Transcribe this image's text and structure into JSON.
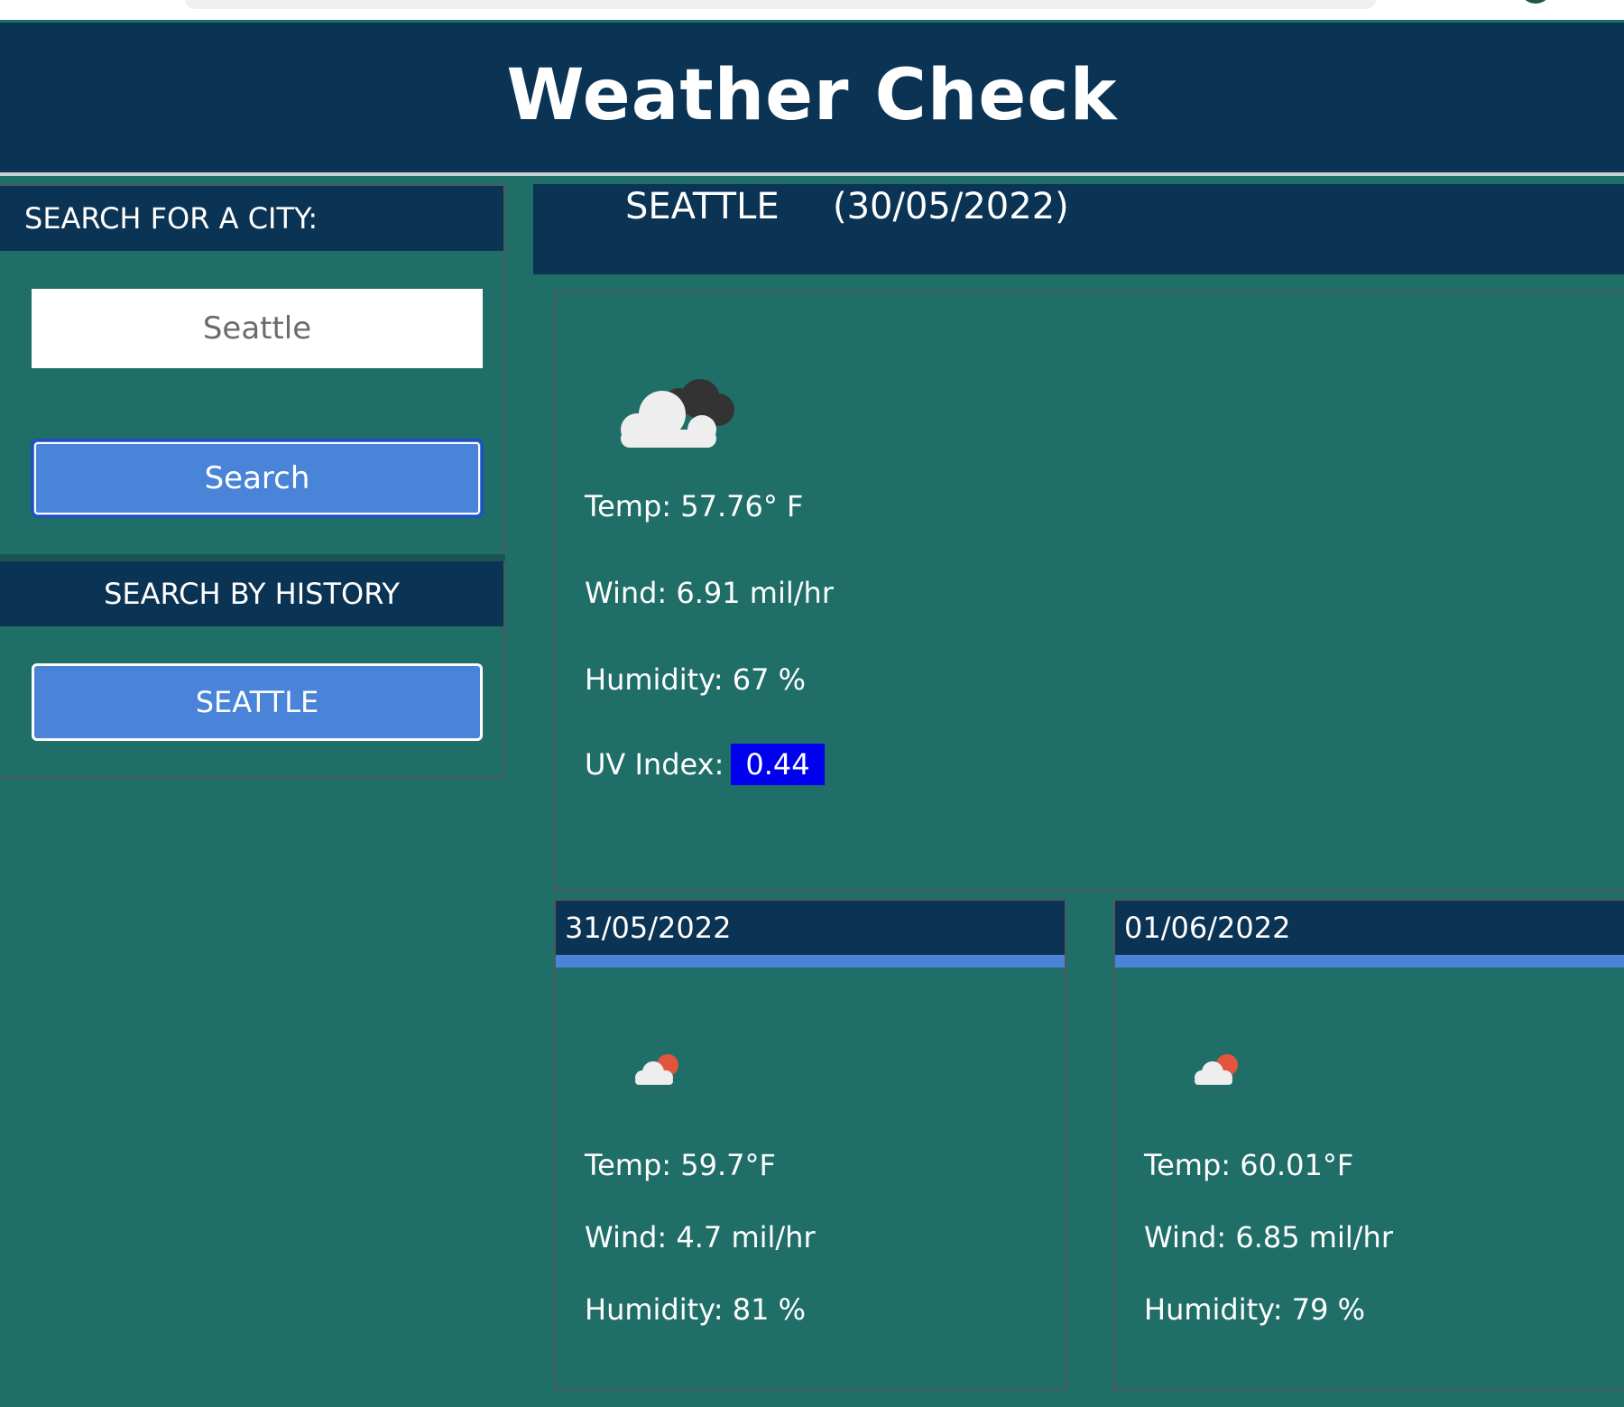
{
  "app": {
    "title": "Weather Check"
  },
  "sidebar": {
    "search_heading": "SEARCH FOR A CITY:",
    "search_value": "Seattle",
    "search_button": "Search",
    "history_heading": "SEARCH BY HISTORY",
    "history": [
      "SEATTLE"
    ]
  },
  "current": {
    "city": "SEATTLE",
    "date": "(30/05/2022)",
    "icon": "cloud-icon",
    "temp": "Temp: 57.76° F",
    "wind": "Wind: 6.91 mil/hr",
    "humidity": "Humidity: 67 %",
    "uv_label": "UV Index:",
    "uv_value": "0.44"
  },
  "forecast": [
    {
      "date": "31/05/2022",
      "icon": "rain-icon",
      "temp": "Temp: 59.7°F",
      "wind": "Wind: 4.7 mil/hr",
      "humidity": "Humidity: 81 %"
    },
    {
      "date": "01/06/2022",
      "icon": "rain-icon",
      "temp": "Temp: 60.01°F",
      "wind": "Wind: 6.85 mil/hr",
      "humidity": "Humidity: 79 %"
    }
  ],
  "colors": {
    "background": "#206e68",
    "header": "#0b3354",
    "button": "#4a84d8",
    "uv_badge": "#0000ee"
  }
}
